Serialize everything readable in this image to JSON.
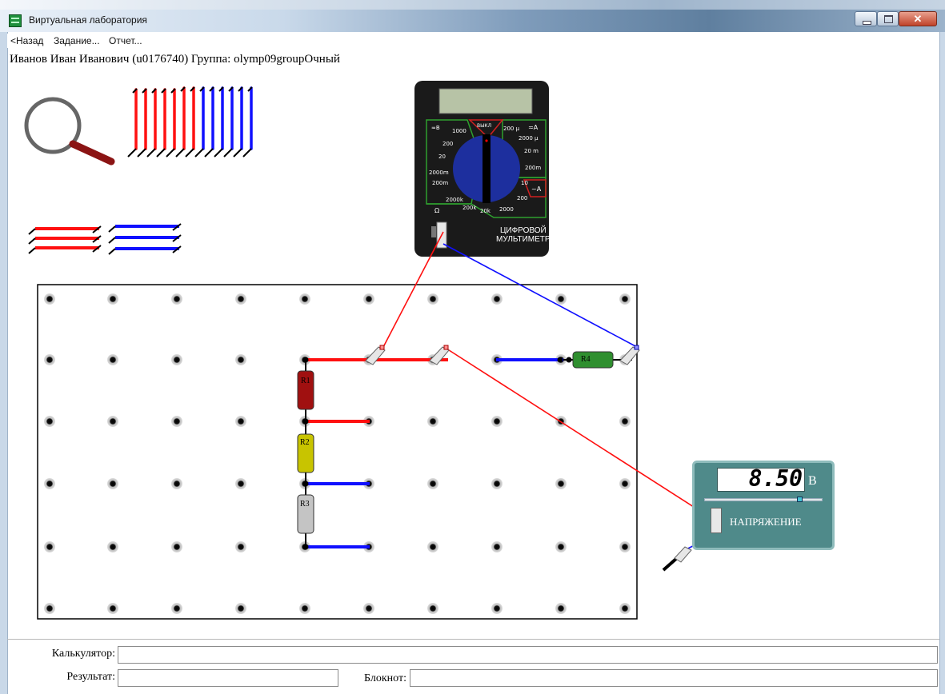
{
  "window": {
    "title": "Виртуальная лаборатория",
    "close_glyph": "✕"
  },
  "menu": {
    "back": "<Назад",
    "task": "Задание...",
    "report": "Отчет..."
  },
  "user": {
    "line": "Иванов Иван Иванович (u0176740)  Группа: olymp09groupОчный"
  },
  "multimeter": {
    "title_line1": "ЦИФРОВОЙ",
    "title_line2": "МУЛЬТИМЕТР",
    "dial_labels": {
      "off": "ВЫКЛ",
      "dcv": "≂В",
      "dca": "≂А",
      "acv": "~А",
      "ohm": "Ω",
      "v1000": "1000",
      "v200": "200",
      "v20": "20",
      "v2000m": "2000m",
      "v200m": "200m",
      "a200u": "200 µ",
      "a2000u": "2000 µ",
      "a20m": "20 m",
      "a200m": "200m",
      "a10": "10",
      "ac200": "200",
      "ac2000": "2000",
      "r2000k": "2000k",
      "r200k": "200k",
      "r20k": "20k"
    },
    "colors": {
      "body": "#1a1a1a",
      "display": "#b7c3a6",
      "dial": "#1d2f9e",
      "pointer": "#000000"
    }
  },
  "resistors": [
    {
      "label": "R1",
      "color": "#a01010"
    },
    {
      "label": "R2",
      "color": "#c8c400"
    },
    {
      "label": "R3",
      "color": "#c4c4c4"
    },
    {
      "label": "R4",
      "color": "#2f8f2f"
    }
  ],
  "voltmeter": {
    "reading": "8.50",
    "unit": "В",
    "label": "НАПРЯЖЕНИЕ",
    "slider_level": 0.82,
    "colors": {
      "panel": "#4f8a8a",
      "display": "#ffffff"
    }
  },
  "wire_colors": {
    "red": "#ff1010",
    "blue": "#1010ff"
  },
  "bottom": {
    "calculator_label": "Калькулятор:",
    "calculator_value": "",
    "result_label": "Результат:",
    "result_value": "",
    "notepad_label": "Блокнот:",
    "notepad_value": ""
  }
}
